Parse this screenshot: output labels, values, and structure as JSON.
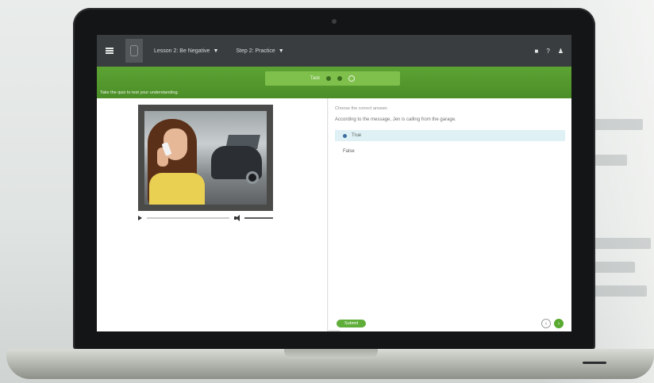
{
  "app": {
    "breadcrumb": {
      "lesson_label": "Lesson 2: Be Negative",
      "step_label": "Step 2: Practice"
    },
    "header_icons": [
      "print-icon",
      "help-icon",
      "user-icon"
    ]
  },
  "greenbar": {
    "pager_label": "Task",
    "instruction": "Take the quiz to test your understanding."
  },
  "quiz": {
    "prompt": "Choose the correct answer.",
    "question": "According to the message, Jen is calling from the garage.",
    "options": [
      {
        "label": "True",
        "selected": true
      },
      {
        "label": "False",
        "selected": false
      }
    ],
    "submit_label": "Submit"
  },
  "colors": {
    "accent_green": "#5da333",
    "topbar": "#3a3d40",
    "selected_option_bg": "#dff1f4"
  },
  "icons": {
    "menu": "menu-icon",
    "play": "play-icon",
    "volume": "volume-icon",
    "prev": "chevron-left-icon",
    "next": "chevron-right-icon"
  }
}
